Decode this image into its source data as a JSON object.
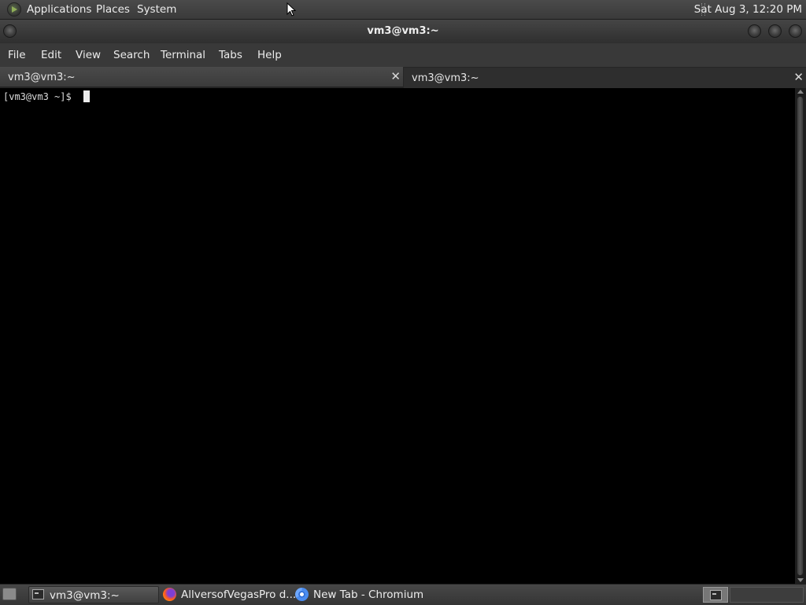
{
  "top_panel": {
    "menus": [
      "Applications",
      "Places",
      "System"
    ],
    "clock": "Sat Aug  3, 12:20 PM"
  },
  "window": {
    "title": "vm3@vm3:~"
  },
  "menu_bar": [
    "File",
    "Edit",
    "View",
    "Search",
    "Terminal",
    "Tabs",
    "Help"
  ],
  "tabs": [
    {
      "label": "vm3@vm3:~",
      "close": "✕",
      "active": true
    },
    {
      "label": "vm3@vm3:~",
      "close": "✕",
      "active": false
    }
  ],
  "terminal": {
    "prompt": "[vm3@vm3 ~]$ "
  },
  "taskbar": {
    "tasks": [
      {
        "label": "vm3@vm3:~",
        "icon": "terminal-icon"
      },
      {
        "label": "AllversofVegasPro d...",
        "icon": "firefox-icon"
      },
      {
        "label": "New Tab - Chromium",
        "icon": "chromium-icon"
      }
    ]
  }
}
